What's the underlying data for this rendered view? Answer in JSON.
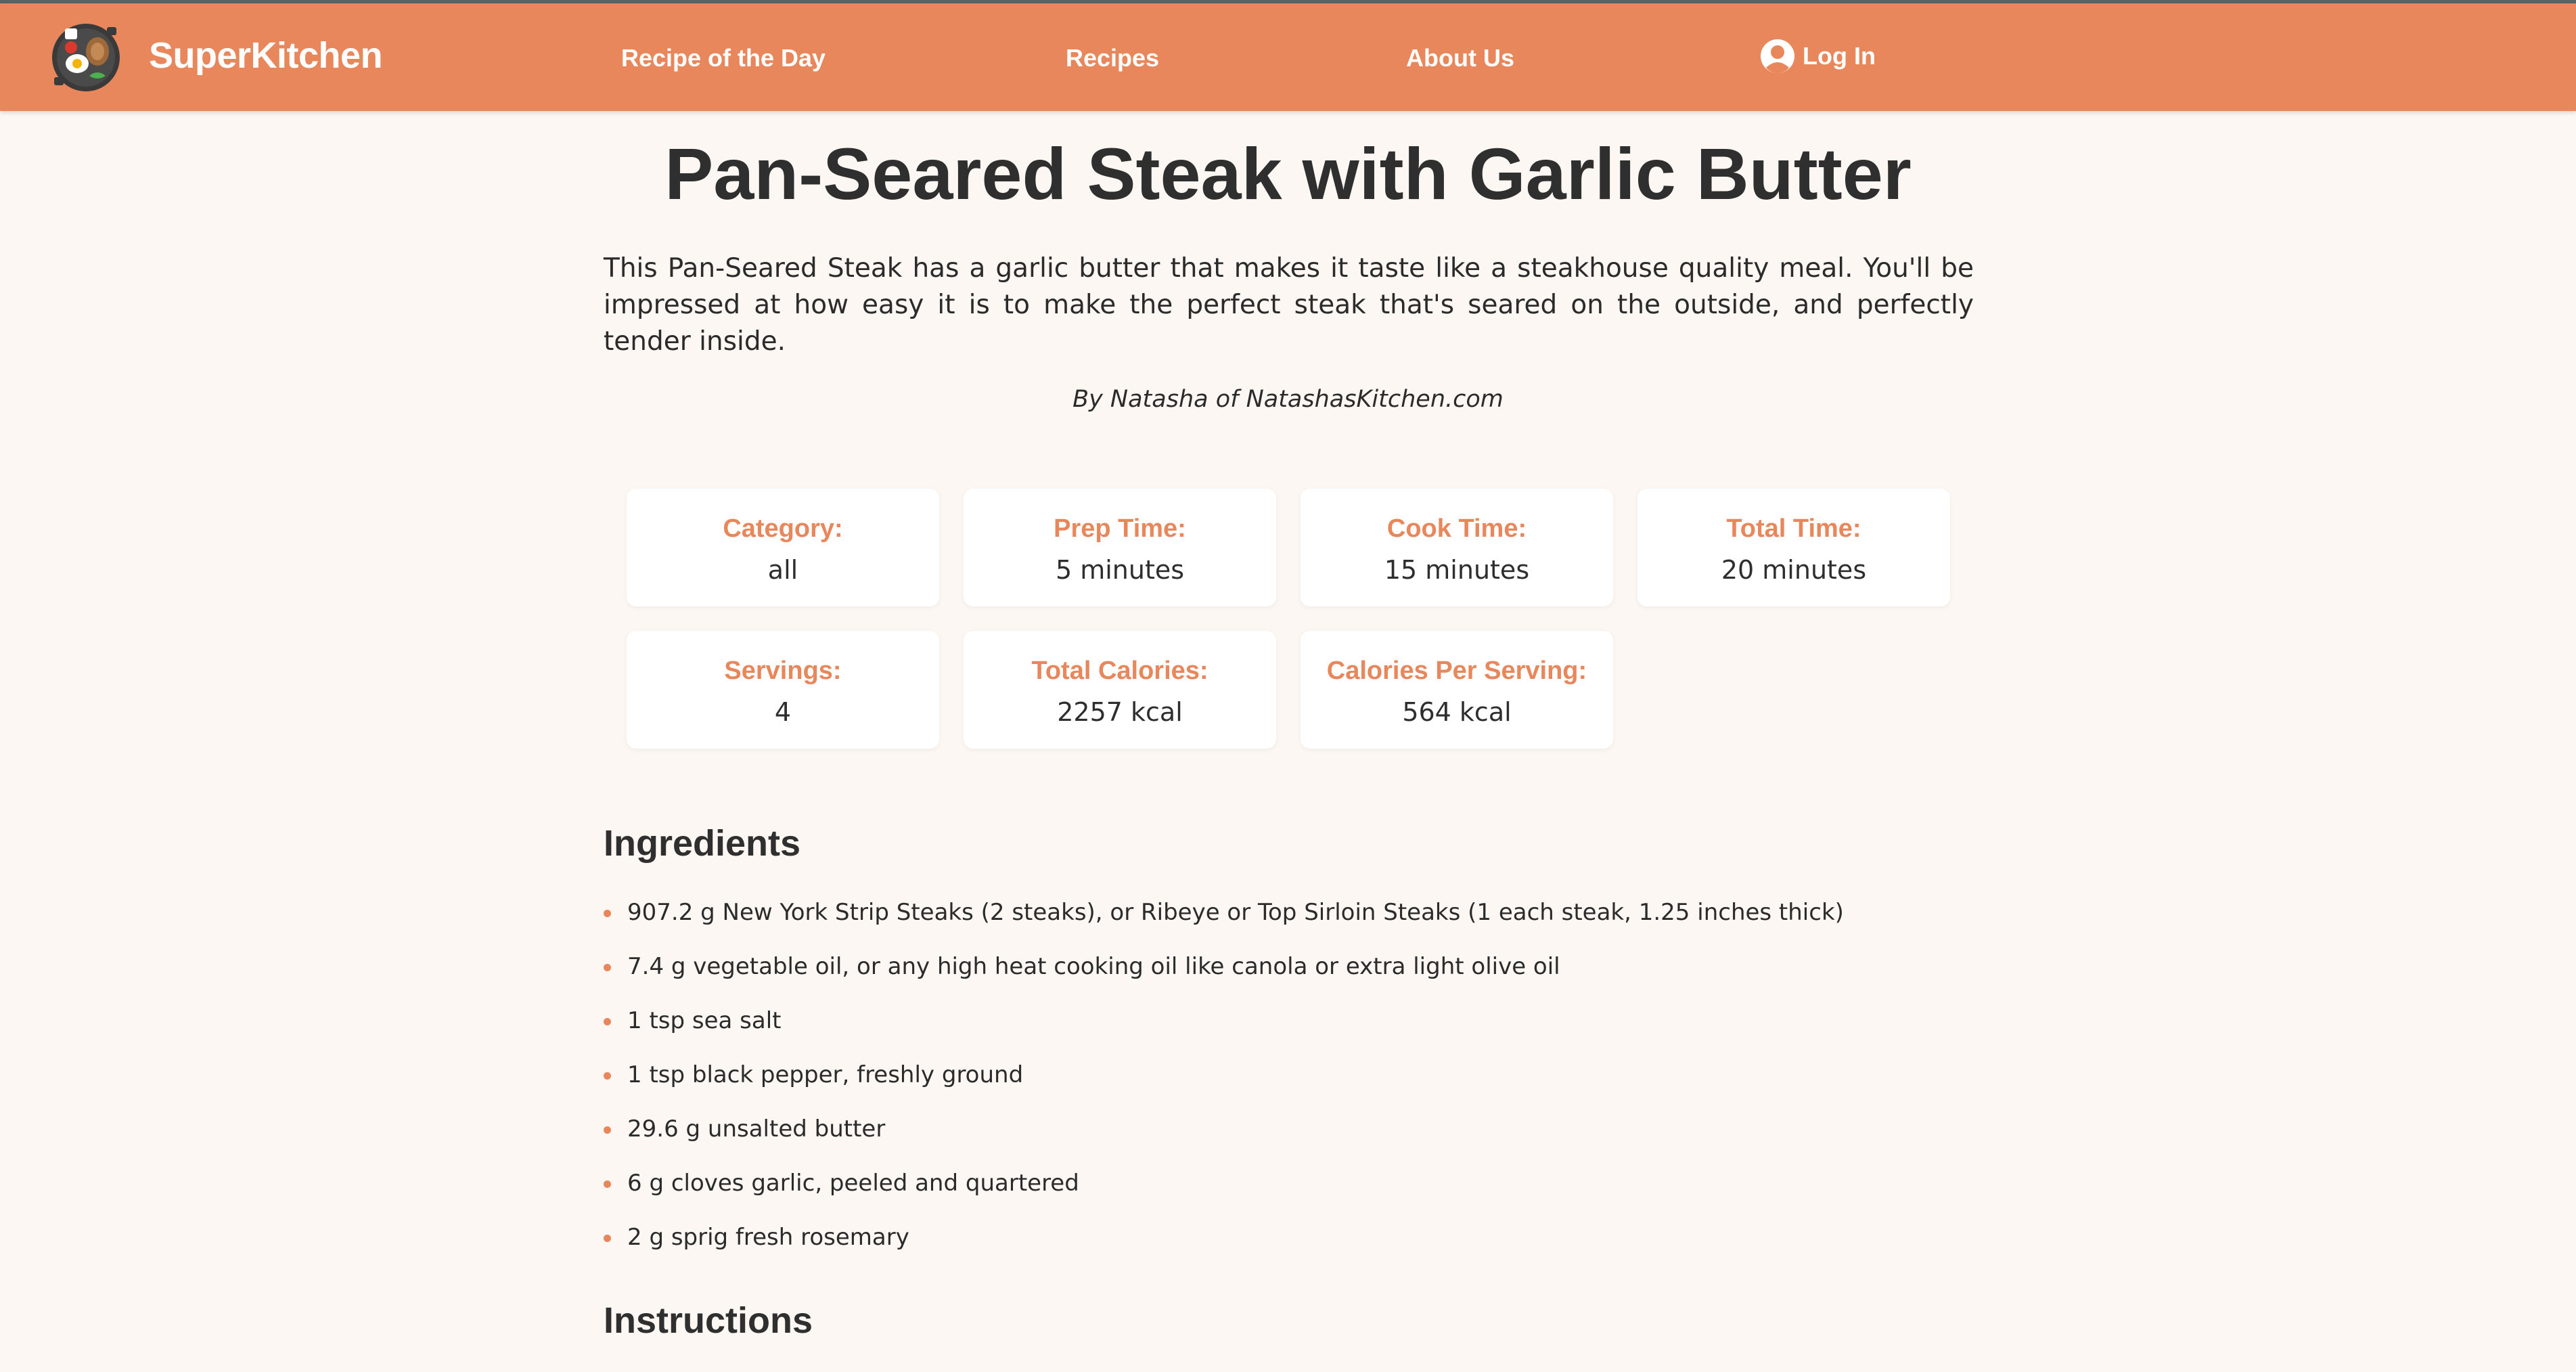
{
  "header": {
    "brand": "SuperKitchen",
    "nav": [
      {
        "label": "Recipe of the Day"
      },
      {
        "label": "Recipes"
      },
      {
        "label": "About Us"
      }
    ],
    "login_label": "Log In",
    "icons": {
      "logo": "frying-pan-logo-icon",
      "login": "user-avatar-icon"
    }
  },
  "recipe": {
    "title": "Pan-Seared Steak with Garlic Butter",
    "description": "This Pan-Seared Steak has a garlic butter that makes it taste like a steakhouse quality meal. You'll be impressed at how easy it is to make the perfect steak that's seared on the outside, and perfectly tender inside.",
    "byline": "By Natasha of NatashasKitchen.com",
    "stats": [
      {
        "label": "Category:",
        "value": "all"
      },
      {
        "label": "Prep Time:",
        "value": "5 minutes"
      },
      {
        "label": "Cook Time:",
        "value": "15 minutes"
      },
      {
        "label": "Total Time:",
        "value": "20 minutes"
      },
      {
        "label": "Servings:",
        "value": "4"
      },
      {
        "label": "Total Calories:",
        "value": "2257 kcal"
      },
      {
        "label": "Calories Per Serving:",
        "value": "564 kcal"
      }
    ],
    "ingredients_heading": "Ingredients",
    "ingredients": [
      "907.2 g New York Strip Steaks (2 steaks), or Ribeye or Top Sirloin Steaks (1 each steak, 1.25 inches thick)",
      "7.4 g vegetable oil, or any high heat cooking oil like canola or extra light olive oil",
      "1 tsp sea salt",
      "1 tsp black pepper, freshly ground",
      "29.6 g unsalted butter",
      "6 g cloves garlic, peeled and quartered",
      "2 g sprig fresh rosemary"
    ],
    "instructions_heading": "Instructions"
  },
  "colors": {
    "accent": "#e8875b",
    "page_background": "#fcf7f3",
    "card_background": "#ffffff",
    "text": "#2e2e2e"
  }
}
